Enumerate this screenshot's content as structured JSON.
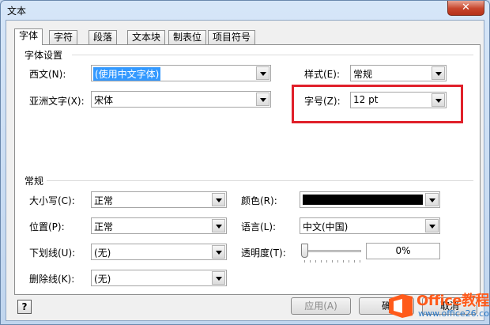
{
  "window": {
    "title": "文本",
    "close_glyph": "✕"
  },
  "tabs": [
    {
      "label": "字体",
      "active": true
    },
    {
      "label": "字符"
    },
    {
      "label": "段落"
    },
    {
      "label": "文本块"
    },
    {
      "label": "制表位"
    },
    {
      "label": "项目符号"
    }
  ],
  "font_settings": {
    "group_title": "字体设置",
    "western_label": "西文(N):",
    "western_value": "(使用中文字体)",
    "asian_label": "亚洲文字(X):",
    "asian_value": "宋体",
    "style_label": "样式(E):",
    "style_value": "常规",
    "size_label": "字号(Z):",
    "size_value": "12 pt"
  },
  "general": {
    "group_title": "常规",
    "case_label": "大小写(C):",
    "case_value": "正常",
    "position_label": "位置(P):",
    "position_value": "正常",
    "underline_label": "下划线(U):",
    "underline_value": "(无)",
    "strike_label": "删除线(K):",
    "strike_value": "(无)",
    "color_label": "颜色(R):",
    "color_value": "#000000",
    "language_label": "语言(L):",
    "language_value": "中文(中国)",
    "transparency_label": "透明度(T):",
    "transparency_value": "0%"
  },
  "footer": {
    "help_glyph": "?",
    "apply_label": "应用(A)",
    "ok_fragment": "确",
    "cancel_fragment": "取消"
  },
  "watermark": {
    "brand": "Office教程网",
    "url": "www.office26.com"
  },
  "colors": {
    "highlight": "#e0202a",
    "selection": "#3399ff",
    "close_button": "#c7452b"
  }
}
